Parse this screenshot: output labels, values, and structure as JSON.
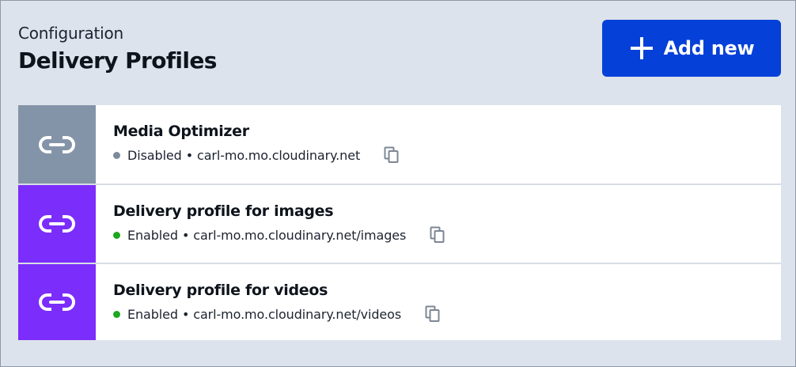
{
  "header": {
    "subtitle": "Configuration",
    "title": "Delivery Profiles"
  },
  "add_button": {
    "label": "Add new",
    "color": "#0540d8"
  },
  "profiles": [
    {
      "name": "Media Optimizer",
      "status": "Disabled",
      "domain": "carl-mo.mo.cloudinary.net",
      "thumb_color": "#8494a8",
      "status_color": "#7d8a9b",
      "icon": "link-icon"
    },
    {
      "name": "Delivery profile for images",
      "status": "Enabled",
      "domain": "carl-mo.mo.cloudinary.net/images",
      "thumb_color": "#7b2dfb",
      "status_color": "#1fa71f",
      "icon": "link-icon"
    },
    {
      "name": "Delivery profile for videos",
      "status": "Enabled",
      "domain": "carl-mo.mo.cloudinary.net/videos",
      "thumb_color": "#7b2dfb",
      "status_color": "#1fa71f",
      "icon": "link-icon"
    }
  ]
}
